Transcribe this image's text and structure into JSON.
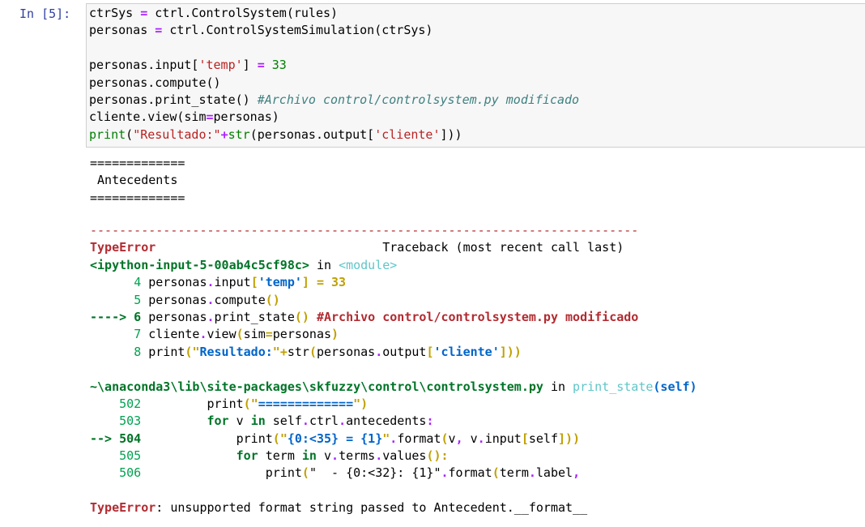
{
  "prompt": "In [5]:",
  "code": [
    "ctrSys = ctrl.ControlSystem(rules)",
    "personas = ctrl.ControlSystemSimulation(ctrSys)",
    "",
    "personas.input['temp'] = 33",
    "personas.compute()",
    "personas.print_state() #Archivo control/controlsystem.py modificado",
    "cliente.view(sim=personas)",
    "print(\"Resultado:\"+str(personas.output['cliente']))"
  ],
  "output": {
    "separator": "=============",
    "antecedents": " Antecedents",
    "dashes": "---------------------------------------------------------------------------",
    "error_name": "TypeError",
    "traceback_label": "Traceback (most recent call last)",
    "frame1_name": "<ipython-input-5-00ab4c5cf98c>",
    "in_word": "in",
    "frame1_module": "<module>",
    "frame1_lines": [
      {
        "arrow": "",
        "num": "4",
        "code": "personas.input['temp'] = 33"
      },
      {
        "arrow": "",
        "num": "5",
        "code": "personas.compute()"
      },
      {
        "arrow": "---->",
        "num": "6",
        "code": "personas.print_state() #Archivo control/controlsystem.py modificado"
      },
      {
        "arrow": "",
        "num": "7",
        "code": "cliente.view(sim=personas)"
      },
      {
        "arrow": "",
        "num": "8",
        "code": "print(\"Resultado:\"+str(personas.output['cliente']))"
      }
    ],
    "frame2_file": "~\\anaconda3\\lib\\site-packages\\skfuzzy\\control\\controlsystem.py",
    "frame2_func": "print_state",
    "frame2_args": "(self)",
    "frame2_lines": [
      {
        "arrow": "",
        "num": "502",
        "code": "print(\"=============\")"
      },
      {
        "arrow": "",
        "num": "503",
        "code": "for v in self.ctrl.antecedents:"
      },
      {
        "arrow": "-->",
        "num": "504",
        "code": "print(\"{0:<35} = {1}\".format(v, v.input[self]))"
      },
      {
        "arrow": "",
        "num": "505",
        "code": "for term in v.terms.values():"
      },
      {
        "arrow": "",
        "num": "506",
        "code": "print(\"  - {0:<32}: {1}\".format(term.label,"
      }
    ],
    "final_error": "unsupported format string passed to Antecedent.__format__"
  }
}
